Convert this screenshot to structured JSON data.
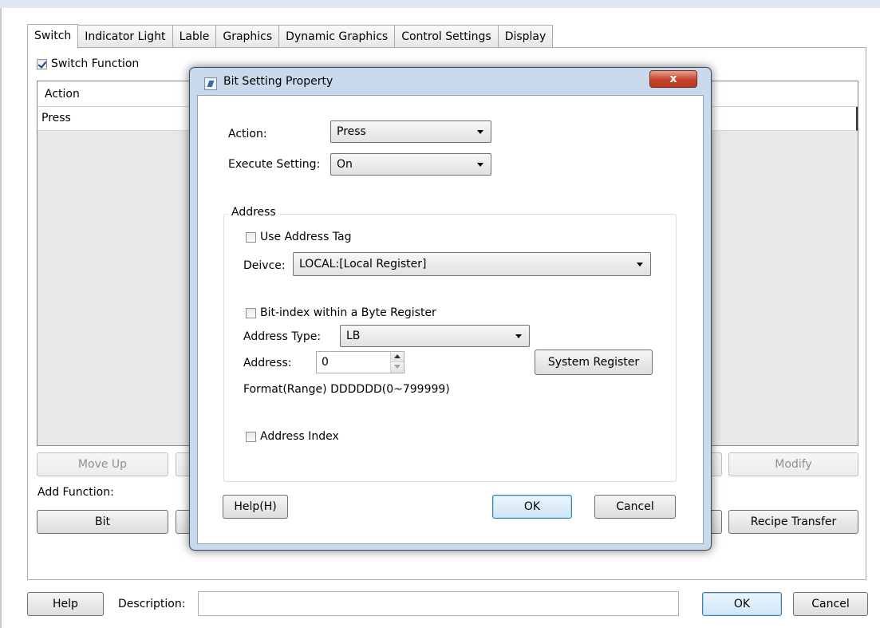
{
  "tabs": [
    "Switch",
    "Indicator Light",
    "Lable",
    "Graphics",
    "Dynamic Graphics",
    "Control Settings",
    "Display"
  ],
  "switch_function": {
    "label": "Switch Function",
    "checked": true
  },
  "list": {
    "columns": [
      "Action"
    ],
    "rows": [
      {
        "action": "Press"
      }
    ]
  },
  "buttons": {
    "move_up": "Move Up",
    "modify": "Modify",
    "bit": "Bit",
    "recipe_transfer": "Recipe Transfer",
    "help": "Help",
    "ok": "OK",
    "cancel": "Cancel"
  },
  "add_function_label": "Add Function:",
  "description": {
    "label": "Description:",
    "value": ""
  },
  "dialog": {
    "title": "Bit Setting Property",
    "close_label": "x",
    "action": {
      "label": "Action:",
      "value": "Press"
    },
    "execute_setting": {
      "label": "Execute Setting:",
      "value": "On"
    },
    "address_group": {
      "legend": "Address",
      "use_address_tag": {
        "label": "Use Address Tag",
        "checked": false
      },
      "device": {
        "label": "Deivce:",
        "value": "LOCAL:[Local Register]"
      },
      "bit_index": {
        "label": "Bit-index within a Byte Register",
        "checked": false
      },
      "address_type": {
        "label": "Address Type:",
        "value": "LB"
      },
      "address": {
        "label": "Address:",
        "value": "0"
      },
      "system_register": "System Register",
      "format_range": "Format(Range) DDDDDD(0~799999)",
      "address_index": {
        "label": "Address Index",
        "checked": false
      }
    },
    "help_button": "Help(H)",
    "ok_button": "OK",
    "cancel_button": "Cancel"
  }
}
